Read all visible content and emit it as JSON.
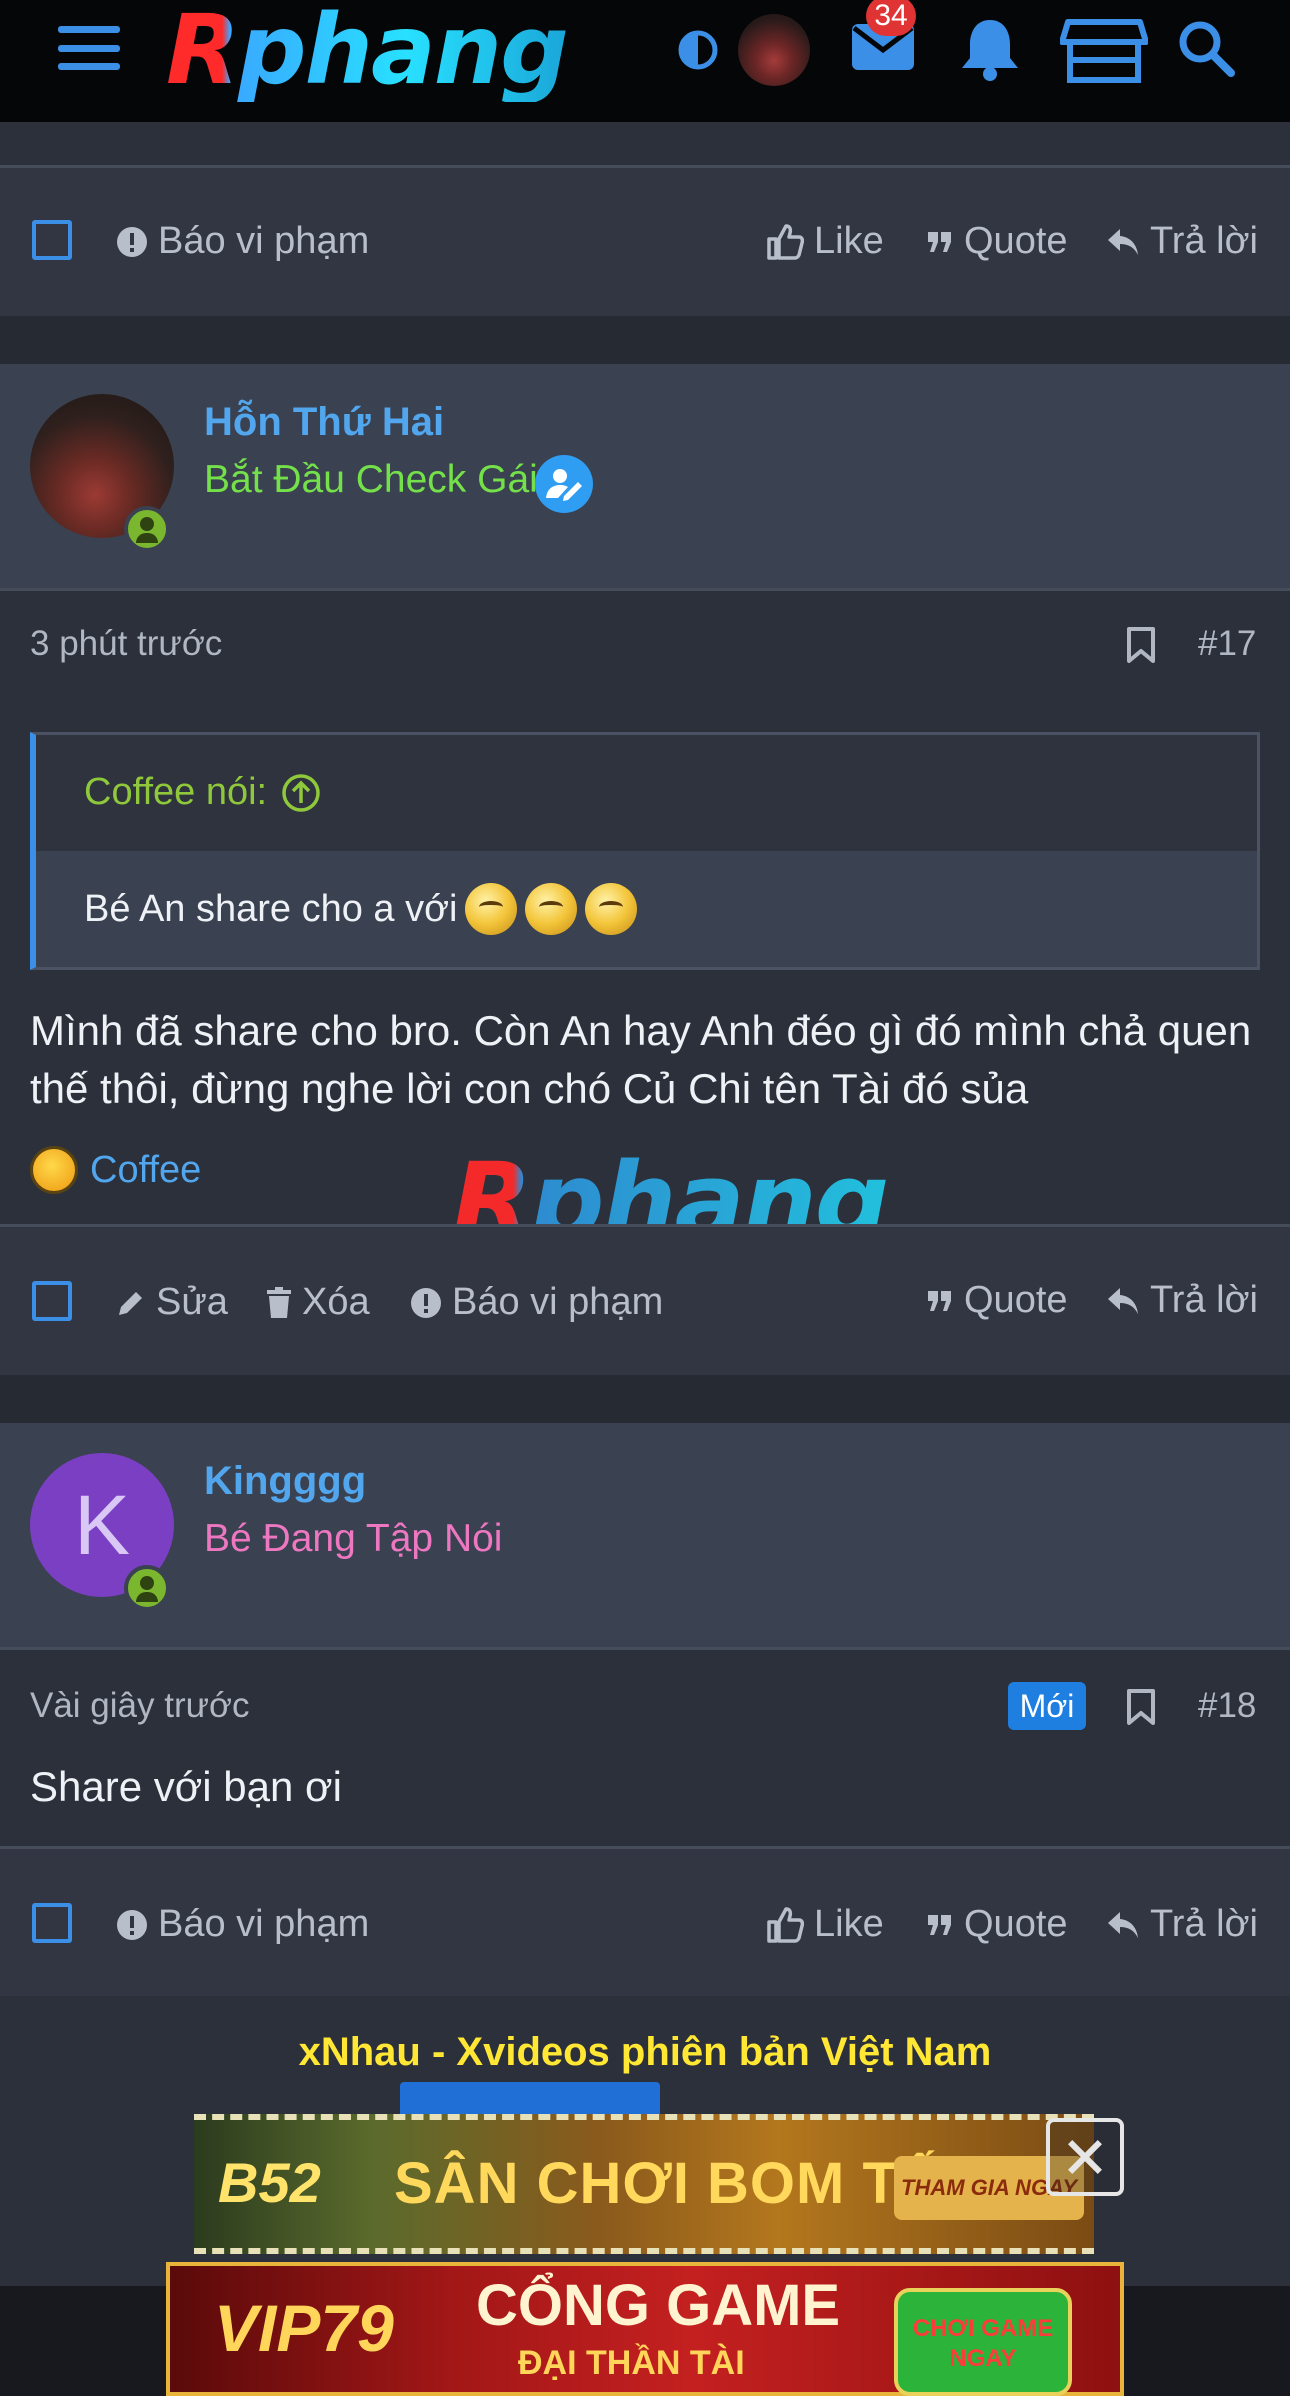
{
  "header": {
    "logo": "Rphang",
    "mail_badge": "34"
  },
  "post16": {
    "actions": {
      "report": "Báo vi phạm",
      "like": "Like",
      "quote": "Quote",
      "reply": "Trả lời"
    }
  },
  "post17": {
    "username": "Hỗn Thứ Hai",
    "user_title": "Bắt Đầu Check Gái",
    "time": "3 phút trước",
    "number": "#17",
    "quote": {
      "author": "Coffee nói:",
      "text": "Bé An share cho a với"
    },
    "body_line1": "Mình đã share cho bro. Còn An hay Anh đéo gì đó mình chả quen",
    "body_line2": "thế thôi, đừng nghe lời con chó Củ Chi tên Tài đó sủa",
    "reaction_user": "Coffee",
    "actions": {
      "edit": "Sửa",
      "delete": "Xóa",
      "report": "Báo vi phạm",
      "quote": "Quote",
      "reply": "Trả lời"
    }
  },
  "watermark": "Rphang",
  "post18": {
    "avatar_letter": "K",
    "username": "Kingggg",
    "user_title": "Bé Đang Tập Nói",
    "time": "Vài giây trước",
    "badge": "Mới",
    "number": "#18",
    "body": "Share với bạn ơi",
    "actions": {
      "report": "Báo vi phạm",
      "like": "Like",
      "quote": "Quote",
      "reply": "Trả lời"
    }
  },
  "ads": {
    "caption": "xNhau - Xvideos phiên bản Việt Nam",
    "banner1": {
      "brand": "B52",
      "title": "SÂN CHƠI BOM TẤN",
      "button": "THAM GIA NGAY"
    },
    "banner2": {
      "brand": "VIP79",
      "title": "CỔNG GAME",
      "subtitle": "ĐẠI THẦN TÀI",
      "button": "CHƠI GAME NGAY"
    }
  },
  "colors": {
    "accent": "#3b8fe6",
    "username": "#52a6ee",
    "title_green": "#74e04a",
    "title_pink": "#ee77c2",
    "quote_author": "#8fc83b",
    "ad_caption": "#ffe733",
    "badge_new": "#1e7fe0"
  }
}
